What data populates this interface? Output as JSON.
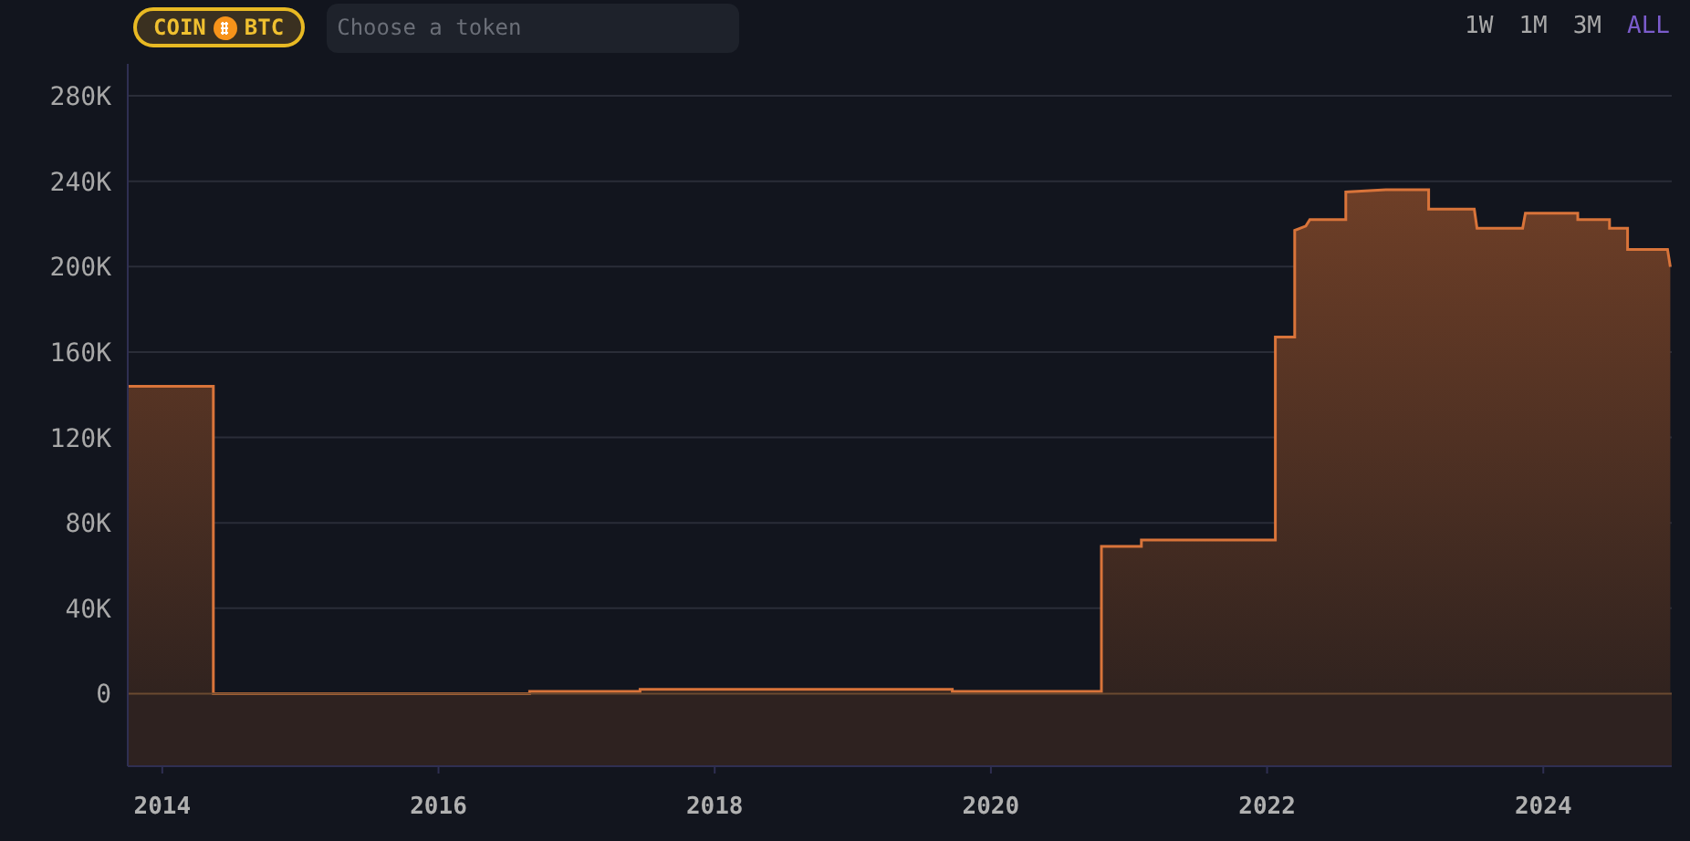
{
  "token_badge": {
    "left": "COIN",
    "right": "BTC"
  },
  "token_search": {
    "placeholder": "Choose a token"
  },
  "ranges": [
    {
      "label": "1W",
      "selected": false
    },
    {
      "label": "1M",
      "selected": false
    },
    {
      "label": "3M",
      "selected": false
    },
    {
      "label": "ALL",
      "selected": true
    }
  ],
  "chart_data": {
    "type": "area",
    "x": [
      2013.75,
      2014.37,
      2014.37,
      2016.66,
      2016.66,
      2017.46,
      2017.46,
      2019.72,
      2019.72,
      2020.8,
      2020.8,
      2021.09,
      2021.09,
      2022.06,
      2022.06,
      2022.2,
      2022.2,
      2022.28,
      2022.31,
      2022.57,
      2022.57,
      2022.86,
      2023.0,
      2023.17,
      2023.17,
      2023.5,
      2023.52,
      2023.85,
      2023.87,
      2024.25,
      2024.25,
      2024.48,
      2024.48,
      2024.61,
      2024.61,
      2024.9,
      2024.92
    ],
    "series": [
      {
        "color": "#d9743a",
        "values": [
          144000,
          144000,
          0,
          0,
          1000,
          1000,
          2000,
          2000,
          1000,
          1000,
          69000,
          69000,
          72000,
          72000,
          167000,
          167000,
          217000,
          219000,
          222000,
          222000,
          235000,
          236000,
          236000,
          236000,
          227000,
          227000,
          218000,
          218000,
          225000,
          225000,
          222000,
          222000,
          218000,
          218000,
          208000,
          208000,
          200000
        ]
      }
    ],
    "grid": true,
    "ref_lines": [
      {
        "axis": "y",
        "value": 0,
        "color": "#6b4a30"
      }
    ],
    "bands": [
      {
        "axis": "y",
        "from": -34000,
        "to": 0,
        "color": "#2e2220"
      }
    ],
    "xlim": [
      2013.75,
      2024.93
    ],
    "ylim": [
      -34000,
      295000
    ],
    "xticks": [
      2014,
      2016,
      2018,
      2020,
      2022,
      2024
    ],
    "yticks": [
      {
        "value": 0,
        "label": "0"
      },
      {
        "value": 40000,
        "label": "40K"
      },
      {
        "value": 80000,
        "label": "80K"
      },
      {
        "value": 120000,
        "label": "120K"
      },
      {
        "value": 160000,
        "label": "160K"
      },
      {
        "value": 200000,
        "label": "200K"
      },
      {
        "value": 240000,
        "label": "240K"
      },
      {
        "value": 280000,
        "label": "280K"
      }
    ]
  }
}
